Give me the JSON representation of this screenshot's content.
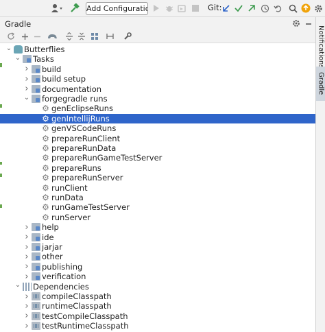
{
  "toolbar": {
    "user_icon": "user-dropdown-icon",
    "build_icon": "hammer-icon",
    "add_configuration_label": "Add Configuration...",
    "git_label": "Git:",
    "icons": [
      "run-icon",
      "debug-icon",
      "coverage-icon",
      "stop-icon",
      "git-update-icon",
      "git-commit-icon",
      "git-push-icon",
      "history-icon",
      "rollback-icon",
      "search-icon",
      "updates-icon",
      "settings-icon"
    ]
  },
  "panel": {
    "title": "Gradle",
    "header_icons": [
      "settings-icon",
      "minimize-icon"
    ],
    "tool_icons": [
      "refresh-icon",
      "add-icon",
      "remove-icon",
      "elephant-icon",
      "expand-all-icon",
      "collapse-all-icon",
      "group-icon",
      "toggle-offline-icon",
      "wrench-icon"
    ]
  },
  "tree": [
    {
      "label": "Butterflies",
      "level": 0,
      "icon": "elephant",
      "expanded": true
    },
    {
      "label": "Tasks",
      "level": 1,
      "icon": "folder",
      "expanded": true
    },
    {
      "label": "build",
      "level": 2,
      "icon": "folder",
      "expanded": false
    },
    {
      "label": "build setup",
      "level": 2,
      "icon": "folder",
      "expanded": false
    },
    {
      "label": "documentation",
      "level": 2,
      "icon": "folder",
      "expanded": false
    },
    {
      "label": "forgegradle runs",
      "level": 2,
      "icon": "folder",
      "expanded": true
    },
    {
      "label": "genEclipseRuns",
      "level": 3,
      "icon": "gear"
    },
    {
      "label": "genIntellijRuns",
      "level": 3,
      "icon": "gear",
      "selected": true
    },
    {
      "label": "genVSCodeRuns",
      "level": 3,
      "icon": "gear"
    },
    {
      "label": "prepareRunClient",
      "level": 3,
      "icon": "gear"
    },
    {
      "label": "prepareRunData",
      "level": 3,
      "icon": "gear"
    },
    {
      "label": "prepareRunGameTestServer",
      "level": 3,
      "icon": "gear"
    },
    {
      "label": "prepareRuns",
      "level": 3,
      "icon": "gear"
    },
    {
      "label": "prepareRunServer",
      "level": 3,
      "icon": "gear"
    },
    {
      "label": "runClient",
      "level": 3,
      "icon": "gear"
    },
    {
      "label": "runData",
      "level": 3,
      "icon": "gear"
    },
    {
      "label": "runGameTestServer",
      "level": 3,
      "icon": "gear"
    },
    {
      "label": "runServer",
      "level": 3,
      "icon": "gear"
    },
    {
      "label": "help",
      "level": 2,
      "icon": "folder",
      "expanded": false
    },
    {
      "label": "ide",
      "level": 2,
      "icon": "folder",
      "expanded": false
    },
    {
      "label": "jarjar",
      "level": 2,
      "icon": "folder",
      "expanded": false
    },
    {
      "label": "other",
      "level": 2,
      "icon": "folder",
      "expanded": false
    },
    {
      "label": "publishing",
      "level": 2,
      "icon": "folder",
      "expanded": false
    },
    {
      "label": "verification",
      "level": 2,
      "icon": "folder",
      "expanded": false
    },
    {
      "label": "Dependencies",
      "level": 1,
      "icon": "deps",
      "expanded": true
    },
    {
      "label": "compileClasspath",
      "level": 2,
      "icon": "lib",
      "expanded": false
    },
    {
      "label": "runtimeClasspath",
      "level": 2,
      "icon": "lib",
      "expanded": false
    },
    {
      "label": "testCompileClasspath",
      "level": 2,
      "icon": "lib",
      "expanded": false
    },
    {
      "label": "testRuntimeClasspath",
      "level": 2,
      "icon": "lib",
      "expanded": false
    }
  ],
  "side_tabs": {
    "notifications": "Notifications",
    "gradle": "Gradle"
  },
  "colors": {
    "selection": "#2f65ca",
    "git_green": "#3e9b4f",
    "update_orange": "#f0a30a"
  }
}
